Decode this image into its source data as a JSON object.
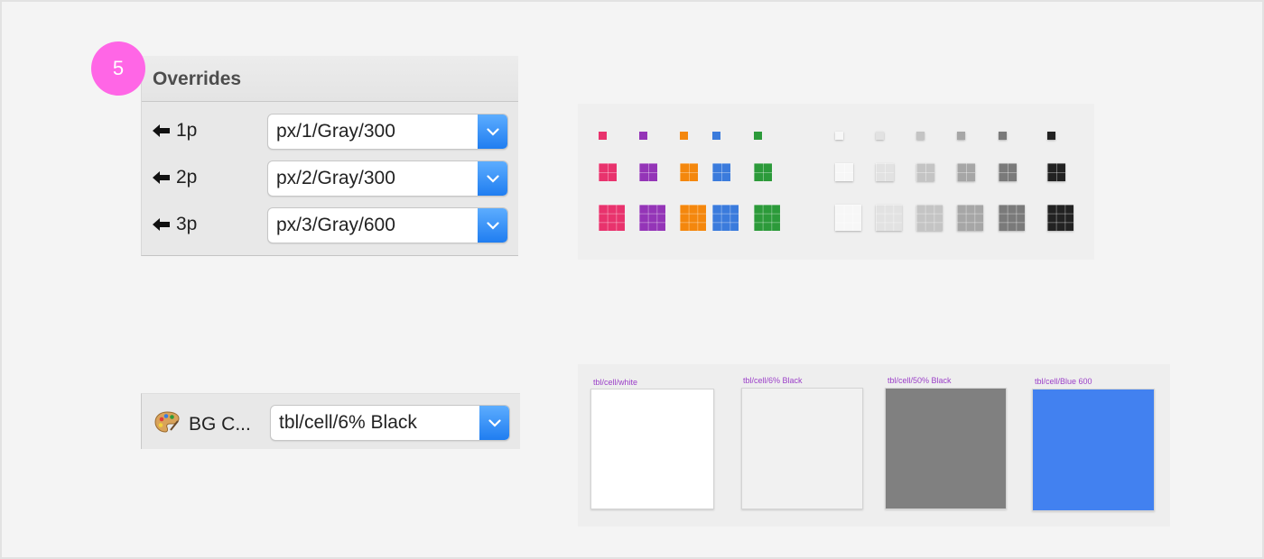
{
  "step": {
    "number": "5"
  },
  "overrides": {
    "title": "Overrides",
    "rows": [
      {
        "label": "1p",
        "value": "px/1/Gray/300"
      },
      {
        "label": "2p",
        "value": "px/2/Gray/300"
      },
      {
        "label": "3p",
        "value": "px/3/Gray/600"
      }
    ]
  },
  "bg_color": {
    "label": "BG C...",
    "value": "tbl/cell/6% Black",
    "icon": "palette-icon"
  },
  "swatches": {
    "colors": [
      "#e8336d",
      "#9435b7",
      "#f4870d",
      "#3b7bdc",
      "#2c9a3a",
      "#f7f7f7",
      "#e2e2e2",
      "#c4c4c4",
      "#a6a6a6",
      "#7a7a7a",
      "#222222"
    ]
  },
  "cells": [
    {
      "label": "tbl/cell/white",
      "color": "#ffffff"
    },
    {
      "label": "tbl/cell/6% Black",
      "color": "#f1f1f1"
    },
    {
      "label": "tbl/cell/50% Black",
      "color": "#808080"
    },
    {
      "label": "tbl/cell/Blue 600",
      "color": "#4281f0"
    }
  ],
  "colors": {
    "badge": "#ff66e6",
    "select_button": "#1e7cf0",
    "cell_label": "#9b3fc8"
  }
}
